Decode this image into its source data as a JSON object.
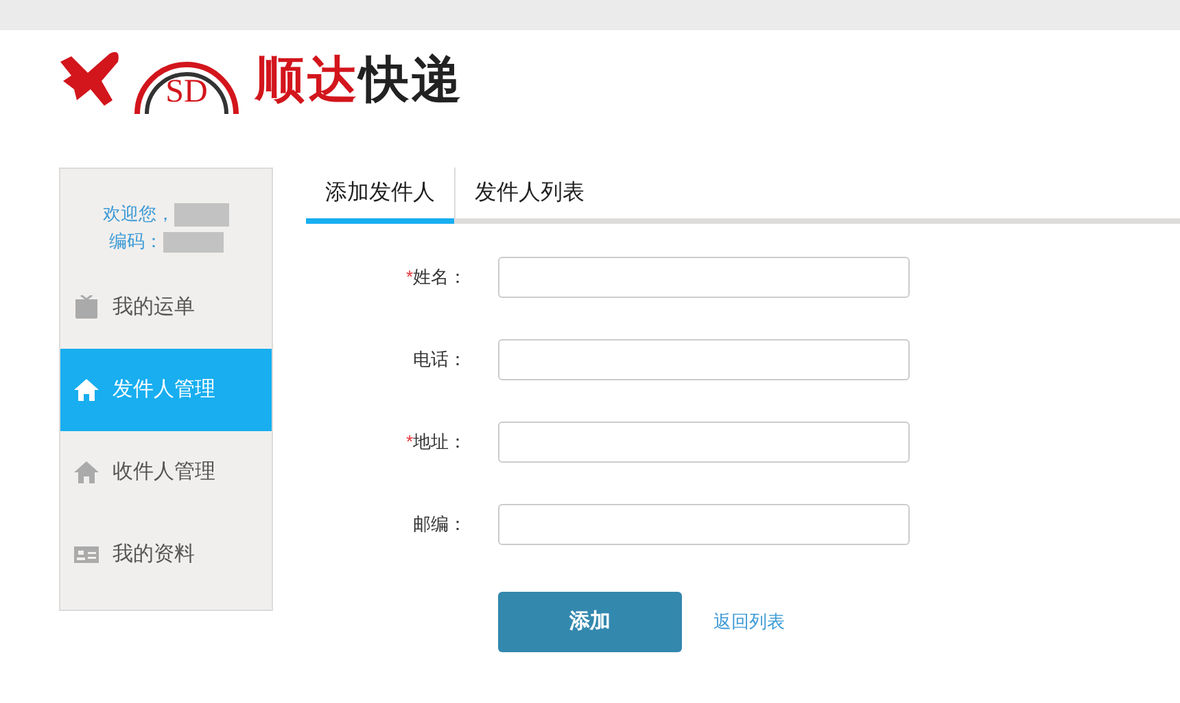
{
  "logo": {
    "badge": "SD",
    "brand_red": "顺达",
    "brand_dark": "快递"
  },
  "sidebar": {
    "welcome": "欢迎您，",
    "code_label": "编码：",
    "items": [
      {
        "label": "我的运单",
        "kind": "gift",
        "selected": false
      },
      {
        "label": "发件人管理",
        "kind": "home",
        "selected": true
      },
      {
        "label": "收件人管理",
        "kind": "home",
        "selected": false
      },
      {
        "label": "我的资料",
        "kind": "card",
        "selected": false
      }
    ]
  },
  "tabs": [
    {
      "label": "添加发件人",
      "selected": true
    },
    {
      "label": "发件人列表",
      "selected": false
    }
  ],
  "form": {
    "fields": [
      {
        "mark": "*",
        "label": "姓名："
      },
      {
        "label": "电话："
      },
      {
        "mark": "*",
        "label": "地址："
      },
      {
        "label": "邮编："
      }
    ],
    "submit": "添加",
    "back_link": "返回列表"
  }
}
